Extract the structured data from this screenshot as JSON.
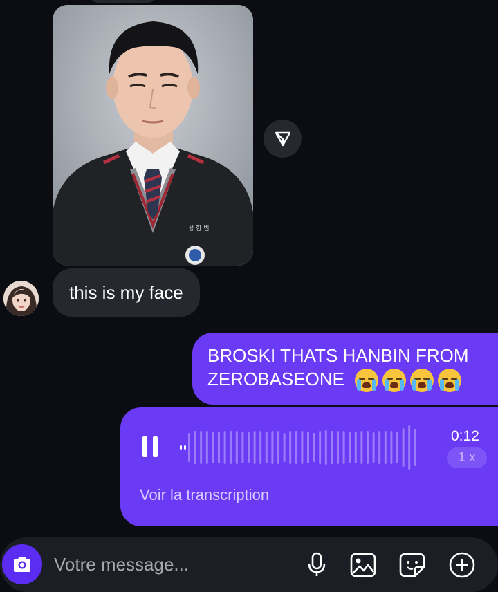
{
  "thread": {
    "photo_message": {
      "photo_kind": "portrait-photo",
      "name_tag": "성 한 빈"
    },
    "received_text": "this is my face",
    "sent_text_lines": [
      "BROSKI THATS HANBIN FROM",
      "ZEROBASEONE"
    ],
    "sent_emojis": [
      "loudly-crying-face",
      "loudly-crying-face",
      "loudly-crying-face",
      "loudly-crying-face"
    ],
    "voice_message": {
      "duration": "0:12",
      "speed": "1 x",
      "transcript_label": "Voir la transcription",
      "state": "playing"
    }
  },
  "composer": {
    "placeholder": "Votre message...",
    "icons": [
      "camera-icon",
      "microphone-icon",
      "gallery-icon",
      "sticker-icon",
      "plus-icon"
    ]
  },
  "colors": {
    "background": "#0b0d12",
    "incoming_bubble": "#262830",
    "outgoing_bubble": "#6b3af5",
    "camera_button": "#5b2cf2",
    "composer": "#1c1e25"
  }
}
